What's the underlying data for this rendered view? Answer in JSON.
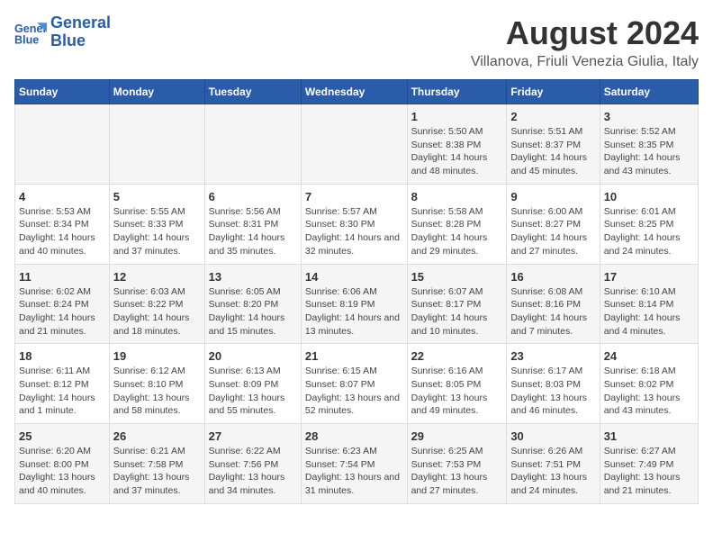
{
  "header": {
    "logo_line1": "General",
    "logo_line2": "Blue",
    "title": "August 2024",
    "subtitle": "Villanova, Friuli Venezia Giulia, Italy"
  },
  "days_of_week": [
    "Sunday",
    "Monday",
    "Tuesday",
    "Wednesday",
    "Thursday",
    "Friday",
    "Saturday"
  ],
  "weeks": [
    [
      {
        "day": "",
        "info": ""
      },
      {
        "day": "",
        "info": ""
      },
      {
        "day": "",
        "info": ""
      },
      {
        "day": "",
        "info": ""
      },
      {
        "day": "1",
        "info": "Sunrise: 5:50 AM\nSunset: 8:38 PM\nDaylight: 14 hours and 48 minutes."
      },
      {
        "day": "2",
        "info": "Sunrise: 5:51 AM\nSunset: 8:37 PM\nDaylight: 14 hours and 45 minutes."
      },
      {
        "day": "3",
        "info": "Sunrise: 5:52 AM\nSunset: 8:35 PM\nDaylight: 14 hours and 43 minutes."
      }
    ],
    [
      {
        "day": "4",
        "info": "Sunrise: 5:53 AM\nSunset: 8:34 PM\nDaylight: 14 hours and 40 minutes."
      },
      {
        "day": "5",
        "info": "Sunrise: 5:55 AM\nSunset: 8:33 PM\nDaylight: 14 hours and 37 minutes."
      },
      {
        "day": "6",
        "info": "Sunrise: 5:56 AM\nSunset: 8:31 PM\nDaylight: 14 hours and 35 minutes."
      },
      {
        "day": "7",
        "info": "Sunrise: 5:57 AM\nSunset: 8:30 PM\nDaylight: 14 hours and 32 minutes."
      },
      {
        "day": "8",
        "info": "Sunrise: 5:58 AM\nSunset: 8:28 PM\nDaylight: 14 hours and 29 minutes."
      },
      {
        "day": "9",
        "info": "Sunrise: 6:00 AM\nSunset: 8:27 PM\nDaylight: 14 hours and 27 minutes."
      },
      {
        "day": "10",
        "info": "Sunrise: 6:01 AM\nSunset: 8:25 PM\nDaylight: 14 hours and 24 minutes."
      }
    ],
    [
      {
        "day": "11",
        "info": "Sunrise: 6:02 AM\nSunset: 8:24 PM\nDaylight: 14 hours and 21 minutes."
      },
      {
        "day": "12",
        "info": "Sunrise: 6:03 AM\nSunset: 8:22 PM\nDaylight: 14 hours and 18 minutes."
      },
      {
        "day": "13",
        "info": "Sunrise: 6:05 AM\nSunset: 8:20 PM\nDaylight: 14 hours and 15 minutes."
      },
      {
        "day": "14",
        "info": "Sunrise: 6:06 AM\nSunset: 8:19 PM\nDaylight: 14 hours and 13 minutes."
      },
      {
        "day": "15",
        "info": "Sunrise: 6:07 AM\nSunset: 8:17 PM\nDaylight: 14 hours and 10 minutes."
      },
      {
        "day": "16",
        "info": "Sunrise: 6:08 AM\nSunset: 8:16 PM\nDaylight: 14 hours and 7 minutes."
      },
      {
        "day": "17",
        "info": "Sunrise: 6:10 AM\nSunset: 8:14 PM\nDaylight: 14 hours and 4 minutes."
      }
    ],
    [
      {
        "day": "18",
        "info": "Sunrise: 6:11 AM\nSunset: 8:12 PM\nDaylight: 14 hours and 1 minute."
      },
      {
        "day": "19",
        "info": "Sunrise: 6:12 AM\nSunset: 8:10 PM\nDaylight: 13 hours and 58 minutes."
      },
      {
        "day": "20",
        "info": "Sunrise: 6:13 AM\nSunset: 8:09 PM\nDaylight: 13 hours and 55 minutes."
      },
      {
        "day": "21",
        "info": "Sunrise: 6:15 AM\nSunset: 8:07 PM\nDaylight: 13 hours and 52 minutes."
      },
      {
        "day": "22",
        "info": "Sunrise: 6:16 AM\nSunset: 8:05 PM\nDaylight: 13 hours and 49 minutes."
      },
      {
        "day": "23",
        "info": "Sunrise: 6:17 AM\nSunset: 8:03 PM\nDaylight: 13 hours and 46 minutes."
      },
      {
        "day": "24",
        "info": "Sunrise: 6:18 AM\nSunset: 8:02 PM\nDaylight: 13 hours and 43 minutes."
      }
    ],
    [
      {
        "day": "25",
        "info": "Sunrise: 6:20 AM\nSunset: 8:00 PM\nDaylight: 13 hours and 40 minutes."
      },
      {
        "day": "26",
        "info": "Sunrise: 6:21 AM\nSunset: 7:58 PM\nDaylight: 13 hours and 37 minutes."
      },
      {
        "day": "27",
        "info": "Sunrise: 6:22 AM\nSunset: 7:56 PM\nDaylight: 13 hours and 34 minutes."
      },
      {
        "day": "28",
        "info": "Sunrise: 6:23 AM\nSunset: 7:54 PM\nDaylight: 13 hours and 31 minutes."
      },
      {
        "day": "29",
        "info": "Sunrise: 6:25 AM\nSunset: 7:53 PM\nDaylight: 13 hours and 27 minutes."
      },
      {
        "day": "30",
        "info": "Sunrise: 6:26 AM\nSunset: 7:51 PM\nDaylight: 13 hours and 24 minutes."
      },
      {
        "day": "31",
        "info": "Sunrise: 6:27 AM\nSunset: 7:49 PM\nDaylight: 13 hours and 21 minutes."
      }
    ]
  ]
}
